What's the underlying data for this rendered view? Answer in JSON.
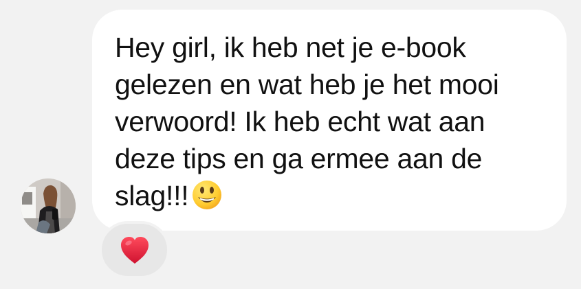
{
  "message": {
    "lines": [
      "Hey girl, ik heb net je e-book",
      "gelezen en wat heb je het mooi",
      "verwoord! Ik heb echt wat aan",
      "deze tips en ga ermee aan de",
      "slag!!!"
    ],
    "emoji": "grinning-face-emoji"
  },
  "reaction": {
    "emoji": "red-heart-emoji"
  },
  "colors": {
    "background": "#f2f2f2",
    "bubble": "#ffffff",
    "text": "#111111",
    "reaction_bg": "#e7e7e7",
    "heart": "#e0243a"
  }
}
